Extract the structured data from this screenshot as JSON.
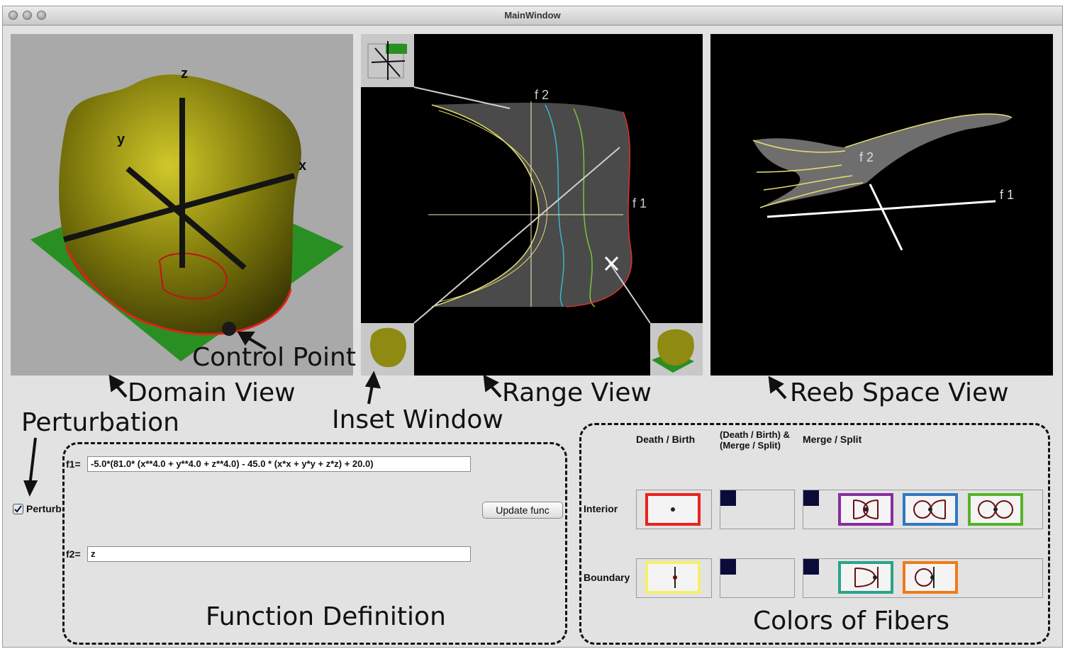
{
  "window": {
    "title": "MainWindow"
  },
  "views": {
    "range": {
      "f1_label": "f 1",
      "f2_label": "f 2"
    },
    "reeb": {
      "f1_label": "f 1",
      "f2_label": "f 2"
    },
    "domain": {
      "x_label": "x",
      "y_label": "y",
      "z_label": "z"
    }
  },
  "annotations": {
    "domain_view": "Domain View",
    "control_point": "Control Point",
    "inset_window": "Inset Window",
    "range_view": "Range View",
    "reeb_space_view": "Reeb Space View",
    "perturbation": "Perturbation",
    "function_definition": "Function Definition",
    "colors_of_fibers": "Colors of Fibers"
  },
  "function_panel": {
    "f1_label": "f1=",
    "f1_value": "-5.0*(81.0* (x**4.0 + y**4.0 + z**4.0) - 45.0 * (x*x + y*y + z*z) + 20.0)",
    "f2_label": "f2=",
    "f2_value": "z",
    "update_button": "Update func",
    "perturb_label": "Perturb",
    "perturb_checked": true
  },
  "fiber_colors": {
    "col_headers": [
      "Death / Birth",
      "(Death / Birth) &",
      "(Merge / Split)",
      "Merge / Split"
    ],
    "row_labels": [
      "Interior",
      "Boundary"
    ],
    "swatch_colors": {
      "interior_birth": "#e8241c",
      "interior_ms_1": "#8a2ca0",
      "interior_ms_2": "#2f78c4",
      "interior_ms_3": "#55b42a",
      "boundary_birth": "#f4f06a",
      "boundary_ms_1": "#2aa38a",
      "boundary_ms_2": "#f07a18"
    }
  }
}
